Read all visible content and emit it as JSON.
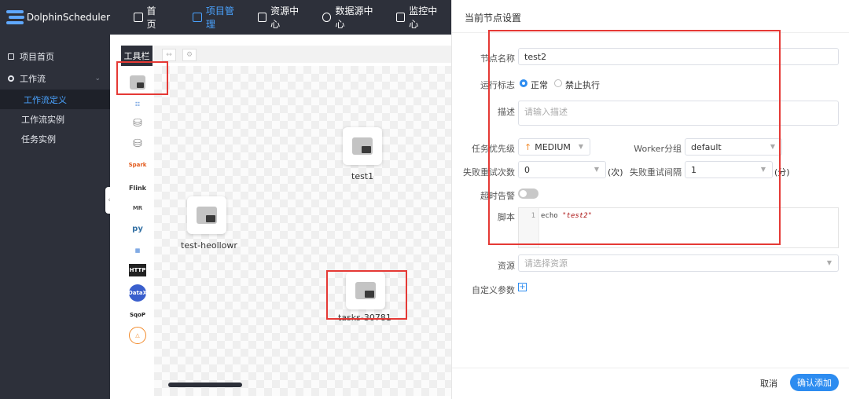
{
  "brand": {
    "name": "DolphinScheduler"
  },
  "topnav": {
    "items": [
      {
        "label": "首页",
        "icon": "home-icon",
        "active": false
      },
      {
        "label": "项目管理",
        "icon": "project-icon",
        "active": true
      },
      {
        "label": "资源中心",
        "icon": "folder-icon",
        "active": false
      },
      {
        "label": "数据源中心",
        "icon": "database-icon",
        "active": false
      },
      {
        "label": "监控中心",
        "icon": "monitor-icon",
        "active": false
      }
    ]
  },
  "sidebar": {
    "home": "项目首页",
    "workflow": "工作流",
    "sub": [
      "工作流定义",
      "工作流实例",
      "任务实例"
    ]
  },
  "canvas": {
    "toolbar_label": "工具栏",
    "tools": [
      "SHELL",
      "SUB_PROCESS",
      "PROCEDURE",
      "SQL",
      "Spark",
      "Flink",
      "MR",
      "py",
      "DEPENDENT",
      "HTTP",
      "DataX",
      "SqoP",
      "CONDITIONS"
    ],
    "nodes": [
      {
        "label": "test1"
      },
      {
        "label": "test-heollowr"
      },
      {
        "label": "tasks-30781"
      }
    ]
  },
  "drawer": {
    "title": "当前节点设置",
    "node_name_label": "节点名称",
    "node_name_value": "test2",
    "run_flag_label": "运行标志",
    "run_normal": "正常",
    "run_forbid": "禁止执行",
    "desc_label": "描述",
    "desc_placeholder": "请输入描述",
    "priority_label": "任务优先级",
    "priority_value": "MEDIUM",
    "worker_label": "Worker分组",
    "worker_value": "default",
    "retry_label": "失败重试次数",
    "retry_value": "0",
    "retry_unit": "(次)",
    "interval_label": "失败重试间隔",
    "interval_value": "1",
    "interval_unit": "(分)",
    "timeout_label": "超时告警",
    "script_label": "脚本",
    "script_line_no": "1",
    "script_cmd": "echo",
    "script_arg": "\"test2\"",
    "resource_label": "资源",
    "resource_placeholder": "请选择资源",
    "custom_params_label": "自定义参数",
    "cancel": "取消",
    "confirm": "确认添加"
  },
  "colors": {
    "accent": "#2d8cf0",
    "nav_bg": "#2d303a",
    "annotation": "#e53935"
  }
}
